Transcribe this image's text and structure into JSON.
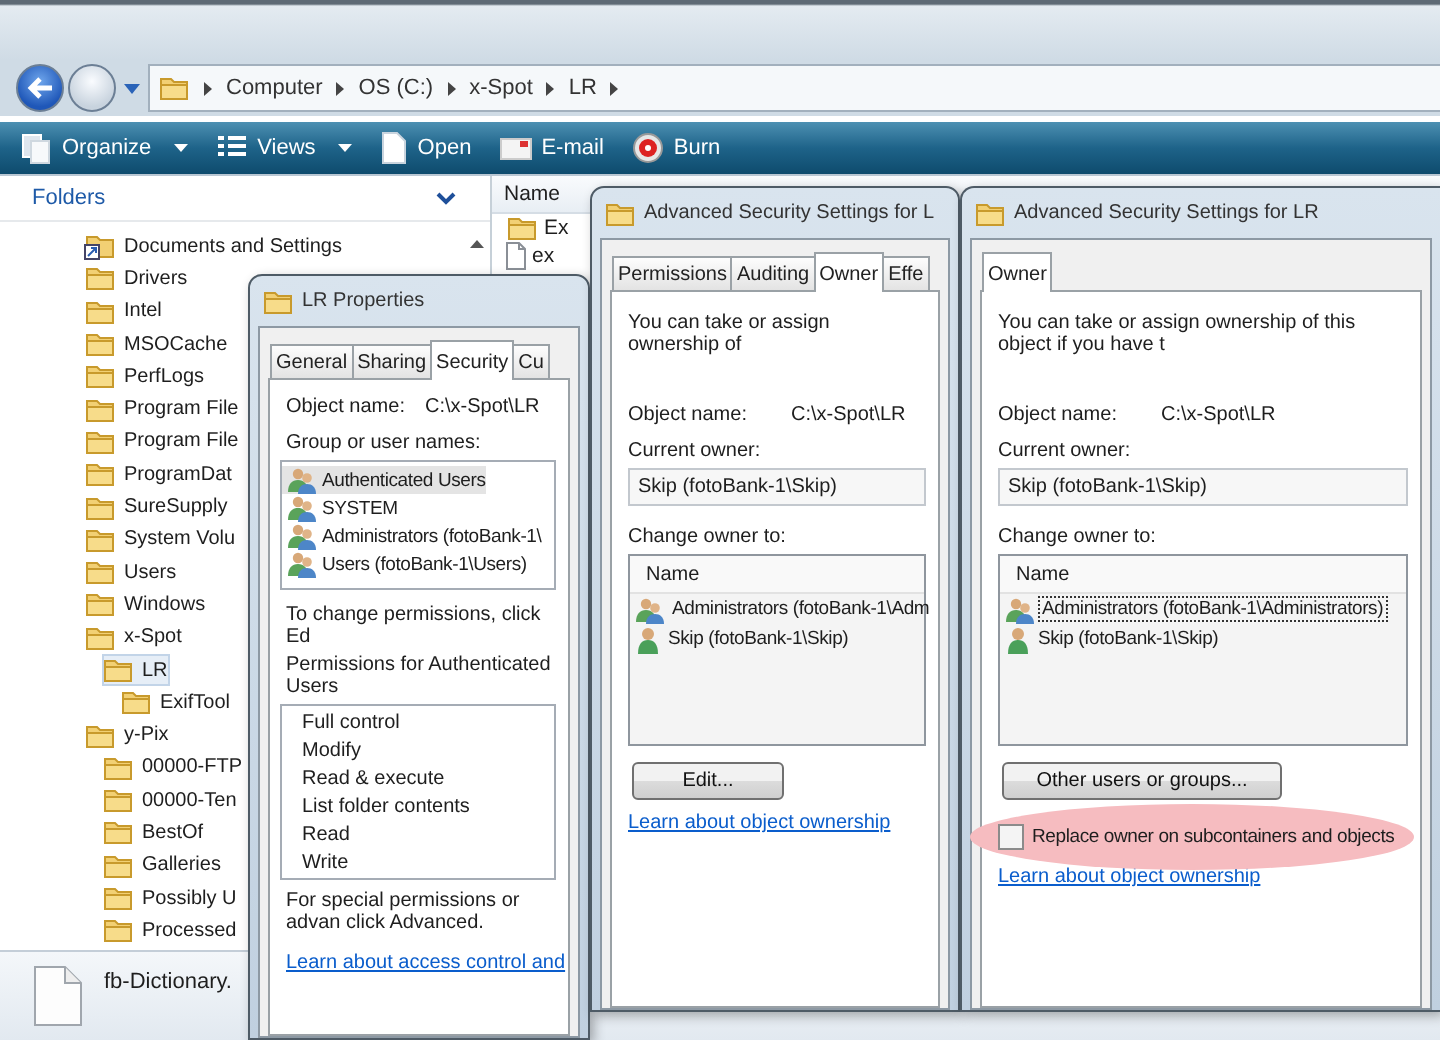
{
  "explorer": {
    "address": [
      "Computer",
      "OS (C:)",
      "x-Spot",
      "LR"
    ],
    "toolbar": [
      {
        "label": "Organize",
        "kind": "organize",
        "dropdown": true
      },
      {
        "label": "Views",
        "kind": "views",
        "dropdown": true
      },
      {
        "label": "Open",
        "kind": "open",
        "dropdown": false
      },
      {
        "label": "E-mail",
        "kind": "email",
        "dropdown": false
      },
      {
        "label": "Burn",
        "kind": "burn",
        "dropdown": false
      }
    ],
    "folders_header": "Folders",
    "tree": [
      {
        "label": "Documents and Settings",
        "kind": "shortcut",
        "selected": false
      },
      {
        "label": "Drivers",
        "kind": "folder",
        "selected": false
      },
      {
        "label": "Intel",
        "kind": "folder",
        "selected": false
      },
      {
        "label": "MSOCache",
        "kind": "folder",
        "selected": false
      },
      {
        "label": "PerfLogs",
        "kind": "folder",
        "selected": false
      },
      {
        "label": "Program File",
        "kind": "folder",
        "selected": false
      },
      {
        "label": "Program File",
        "kind": "folder",
        "selected": false
      },
      {
        "label": "ProgramDat",
        "kind": "folder",
        "selected": false
      },
      {
        "label": "SureSupply",
        "kind": "folder",
        "selected": false
      },
      {
        "label": "System Volu",
        "kind": "folder",
        "selected": false
      },
      {
        "label": "Users",
        "kind": "folder",
        "selected": false
      },
      {
        "label": "Windows",
        "kind": "folder",
        "selected": false
      },
      {
        "label": "x-Spot",
        "kind": "folder",
        "selected": false,
        "children": [
          {
            "label": "LR",
            "kind": "folder",
            "selected": true,
            "children": [
              {
                "label": "ExifTool",
                "kind": "folder",
                "selected": false
              }
            ]
          }
        ]
      },
      {
        "label": "y-Pix",
        "kind": "folder",
        "selected": false,
        "children": [
          {
            "label": "00000-FTP",
            "kind": "folder",
            "selected": false
          },
          {
            "label": "00000-Ten",
            "kind": "folder",
            "selected": false
          },
          {
            "label": "BestOf",
            "kind": "folder",
            "selected": false
          },
          {
            "label": "Galleries",
            "kind": "folder",
            "selected": false
          },
          {
            "label": "Possibly U",
            "kind": "folder",
            "selected": false
          },
          {
            "label": "Processed",
            "kind": "folder",
            "selected": false
          }
        ]
      }
    ],
    "file_list": {
      "columns": [
        "Name"
      ],
      "rows": [
        {
          "name": "Ex",
          "kind": "folder"
        },
        {
          "name": "ex",
          "kind": "file"
        }
      ]
    },
    "details": {
      "name": "fb-Dictionary."
    }
  },
  "dialogs": [
    {
      "kind": "properties",
      "title": "LR Properties",
      "tabs": [
        {
          "label": "General",
          "selected": false
        },
        {
          "label": "Sharing",
          "selected": false
        },
        {
          "label": "Security",
          "selected": true
        },
        {
          "label": "Cu",
          "selected": false
        }
      ],
      "object_name": {
        "label": "Object name:",
        "value": "C:\\x-Spot\\LR"
      },
      "group_label": "Group or user names:",
      "users": [
        {
          "name": "Authenticated Users",
          "kind": "group",
          "selected": true
        },
        {
          "name": "SYSTEM",
          "kind": "group",
          "selected": false
        },
        {
          "name": "Administrators (fotoBank-1\\",
          "kind": "group",
          "selected": false
        },
        {
          "name": "Users (fotoBank-1\\Users)",
          "kind": "group",
          "selected": false
        }
      ],
      "change_note": "To change permissions, click Ed",
      "permissions_label": "Permissions for Authenticated Users",
      "permissions": [
        "Full control",
        "Modify",
        "Read & execute",
        "List folder contents",
        "Read",
        "Write"
      ],
      "special_note": "For special permissions or advan click Advanced.",
      "link": "Learn about access control and"
    },
    {
      "kind": "advanced",
      "title": "Advanced Security Settings for L",
      "tabs": [
        {
          "label": "Permissions",
          "selected": false
        },
        {
          "label": "Auditing",
          "selected": false
        },
        {
          "label": "Owner",
          "selected": true
        },
        {
          "label": "Effe",
          "selected": false
        }
      ],
      "intro": "You can take or assign ownership of",
      "object_name": {
        "label": "Object name:",
        "value": "C:\\x-Spot\\LR"
      },
      "current_owner": {
        "label": "Current owner:",
        "value": "Skip (fotoBank-1\\Skip)"
      },
      "change_label": "Change owner to:",
      "list": {
        "header": "Name",
        "rows": [
          {
            "name": "Administrators (fotoBank-1\\Adm",
            "kind": "group",
            "focused": false
          },
          {
            "name": "Skip (fotoBank-1\\Skip)",
            "kind": "user",
            "focused": false
          }
        ]
      },
      "button": "Edit...",
      "link": "Learn about object ownership"
    },
    {
      "kind": "advanced",
      "title": "Advanced Security Settings for LR",
      "tabs": [
        {
          "label": "Owner",
          "selected": true
        }
      ],
      "intro": "You can take or assign ownership of this object if you have t",
      "object_name": {
        "label": "Object name:",
        "value": "C:\\x-Spot\\LR"
      },
      "current_owner": {
        "label": "Current owner:",
        "value": "Skip (fotoBank-1\\Skip)"
      },
      "change_label": "Change owner to:",
      "list": {
        "header": "Name",
        "rows": [
          {
            "name": "Administrators (fotoBank-1\\Administrators)",
            "kind": "group",
            "focused": true
          },
          {
            "name": "Skip (fotoBank-1\\Skip)",
            "kind": "user",
            "focused": false
          }
        ]
      },
      "button": "Other users or groups...",
      "checkbox": {
        "label": "Replace owner on subcontainers and objects",
        "checked": false,
        "highlighted": true
      },
      "link": "Learn about object ownership"
    }
  ]
}
